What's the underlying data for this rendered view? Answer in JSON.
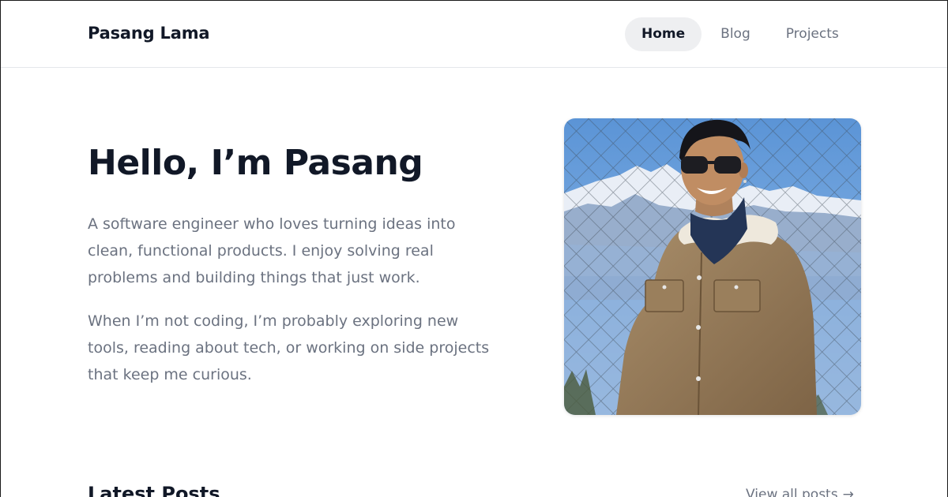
{
  "header": {
    "brand": "Pasang Lama",
    "nav": [
      {
        "label": "Home",
        "active": true
      },
      {
        "label": "Blog",
        "active": false
      },
      {
        "label": "Projects",
        "active": false
      }
    ]
  },
  "hero": {
    "title": "Hello, I’m Pasang",
    "paragraphs": [
      "A software engineer who loves turning ideas into clean, functional products. I enjoy solving real problems and building things that just work.",
      "When I’m not coding, I’m probably exploring new tools, reading about tech, or working on side projects that keep me curious."
    ]
  },
  "latest": {
    "title": "Latest Posts",
    "view_all": "View all posts",
    "arrow_icon": "arrow-right-icon"
  },
  "colors": {
    "text_primary": "#111827",
    "text_muted": "#6b7280",
    "nav_active_bg": "#eeeff1",
    "divider": "#e5e7eb"
  }
}
